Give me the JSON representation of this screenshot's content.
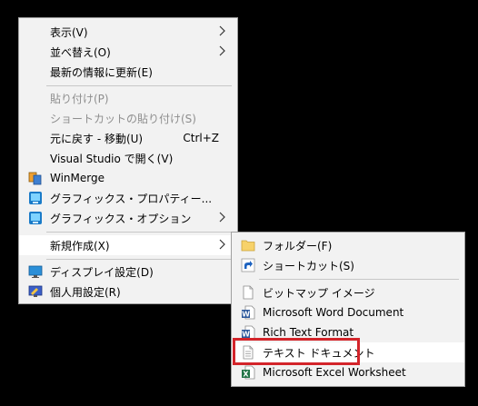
{
  "context_menu": {
    "items": [
      {
        "label": "表示(V)"
      },
      {
        "label": "並べ替え(O)"
      },
      {
        "label": "最新の情報に更新(E)"
      },
      {
        "label": "貼り付け(P)"
      },
      {
        "label": "ショートカットの貼り付け(S)"
      },
      {
        "label": "元に戻す - 移動(U)",
        "shortcut": "Ctrl+Z"
      },
      {
        "label": "Visual Studio で開く(V)"
      },
      {
        "label": "WinMerge"
      },
      {
        "label": "グラフィックス・プロパティー..."
      },
      {
        "label": "グラフィックス・オプション"
      },
      {
        "label": "新規作成(X)"
      },
      {
        "label": "ディスプレイ設定(D)"
      },
      {
        "label": "個人用設定(R)"
      }
    ]
  },
  "submenu": {
    "items": [
      {
        "label": "フォルダー(F)"
      },
      {
        "label": "ショートカット(S)"
      },
      {
        "label": "ビットマップ イメージ"
      },
      {
        "label": "Microsoft Word Document"
      },
      {
        "label": "Rich Text Format"
      },
      {
        "label": "テキスト ドキュメント"
      },
      {
        "label": "Microsoft Excel Worksheet"
      }
    ]
  },
  "colors": {
    "menu_bg": "#f2f2f2",
    "highlight_bg": "#ffffff",
    "disabled_text": "#8e8e8e",
    "annotation_red": "#d3242a"
  }
}
